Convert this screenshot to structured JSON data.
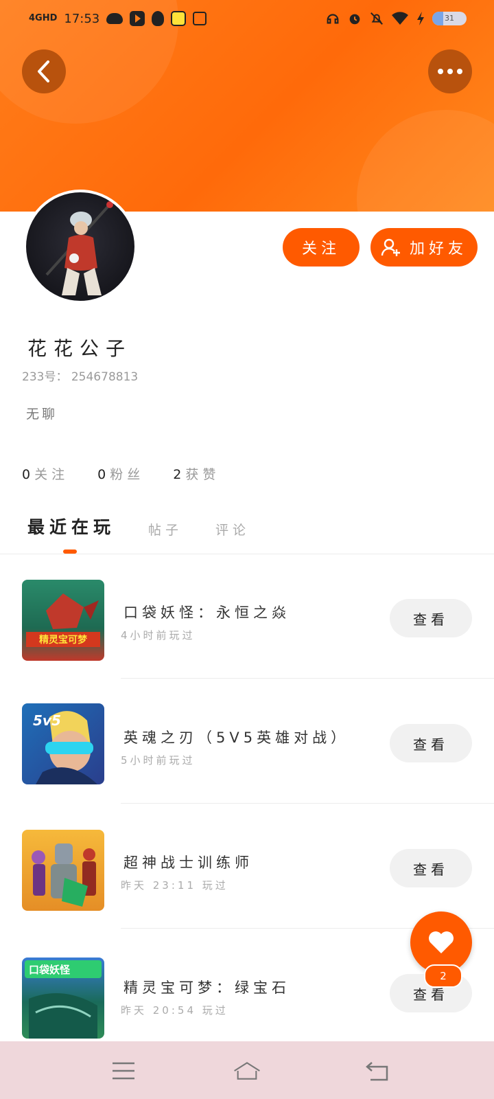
{
  "status_bar": {
    "network": "4GHD",
    "time": "17:53",
    "battery": "31",
    "left_icons": [
      "cloud-icon",
      "video-app-icon",
      "qq-penguin-icon",
      "qq-browser-icon",
      "baidu-icon"
    ],
    "right_icons": [
      "headphones-icon",
      "alarm-icon",
      "mute-icon",
      "wifi-icon",
      "charging-icon"
    ]
  },
  "header": {
    "back_icon": "back-chevron-icon",
    "more_icon": "more-dots-icon",
    "accent": "#ff5a00"
  },
  "profile": {
    "name": "花花公子",
    "uid_label": "233号：",
    "uid_value": "254678813",
    "bio": "无聊",
    "follow_label": "关注",
    "add_friend_label": "加好友"
  },
  "stats": [
    {
      "count": "0",
      "label": "关注"
    },
    {
      "count": "0",
      "label": "粉丝"
    },
    {
      "count": "2",
      "label": "获赞"
    }
  ],
  "tabs": [
    {
      "label": "最近在玩",
      "active": true
    },
    {
      "label": "帖子",
      "active": false
    },
    {
      "label": "评论",
      "active": false
    }
  ],
  "games": [
    {
      "title": "口袋妖怪：永恒之焱",
      "time": "4小时前玩过",
      "button": "查看"
    },
    {
      "title": "英魂之刃（5V5英雄对战）",
      "time": "5小时前玩过",
      "button": "查看"
    },
    {
      "title": "超神战士训练师",
      "time": "昨天 23:11 玩过",
      "button": "查看"
    },
    {
      "title": "精灵宝可梦：绿宝石",
      "time": "昨天 20:54 玩过",
      "button": "查看"
    }
  ],
  "thumb_text": {
    "game1": "精灵宝可梦",
    "game2": "5v5",
    "game4": "口袋妖怪"
  },
  "like_fab": {
    "count": "2"
  },
  "nav_bar": {
    "items": [
      "menu-icon",
      "home-icon",
      "return-icon"
    ]
  }
}
